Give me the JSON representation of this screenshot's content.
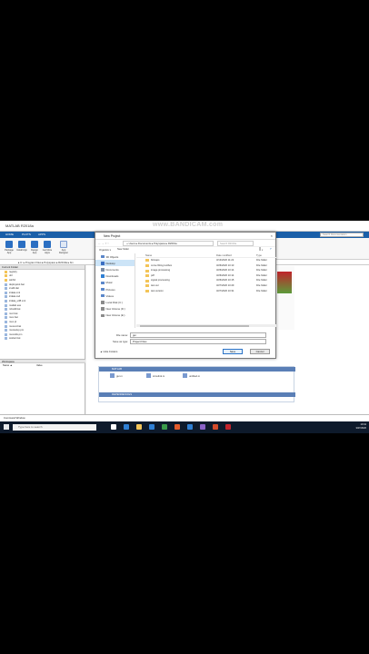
{
  "app": {
    "title": "MATLAB R2018a",
    "watermark": "www.BANDICAM.com",
    "search_placeholder": "Search Documentation"
  },
  "ribbon": {
    "tabs": [
      "HOME",
      "PLOTS",
      "APPS"
    ],
    "buttons": [
      "Package App",
      "Install App",
      "Design App",
      "Get More Apps",
      "App Designer"
    ]
  },
  "address": {
    "path": "▸ C: ▸ Program Files ▸ Polyspace ▸ R2019a ▸ bin"
  },
  "left_panel": {
    "header": "Current Folder",
    "files": [
      "registry",
      "util",
      "win64",
      "deploytool.bat",
      "icudtl.dat",
      "lcdata.xml",
      "lcdata.xsd",
      "lcdata_utf8.xml",
      "matlab.exe",
      "mbuild.bat",
      "mcc.bat",
      "mex.bat",
      "mex.pl",
      "mexext.bat",
      "mexsetup.pm",
      "mexutils.pm",
      "worker.bat"
    ],
    "workspace_header": "Workspace",
    "ws_cols": [
      "Name ▲",
      "Value"
    ]
  },
  "bg_panel": {
    "bar1": "MATLAB",
    "items": [
      "gui.m",
      "simulink.m",
      "untitled.m"
    ],
    "bar2": "DEPENDENCIES"
  },
  "command_window": {
    "label": "Command Window"
  },
  "taskbar": {
    "search": "Type here to search",
    "time": "10:41",
    "date": "3/27/2020",
    "icon_colors": [
      "#ffffff",
      "#2f7fd3",
      "#f3c458",
      "#2f7fd3",
      "#3a9a4a",
      "#e35b2b",
      "#2f7fd3",
      "#8a62c7",
      "#d34b2b",
      "#c2232b"
    ]
  },
  "dialog": {
    "title": "New Project",
    "breadcrumb": "‹‹ Users ▸ Documents ▸ Polyspace ▸ R2019a",
    "search_placeholder": "Search R2019a",
    "organize": "Organize ▾",
    "new_folder": "New folder",
    "sidebar": [
      {
        "label": "3D Objects",
        "color": "#5a86c9"
      },
      {
        "label": "Desktop",
        "color": "#3b6fc2"
      },
      {
        "label": "Documents",
        "color": "#7a8ca5"
      },
      {
        "label": "Downloads",
        "color": "#2f7fd3"
      },
      {
        "label": "Music",
        "color": "#5a86c9"
      },
      {
        "label": "Pictures",
        "color": "#5a86c9"
      },
      {
        "label": "Videos",
        "color": "#5a86c9"
      },
      {
        "label": "Local Disk (C:)",
        "color": "#8a8a8a"
      },
      {
        "label": "New Volume (D:)",
        "color": "#8a8a8a"
      },
      {
        "label": "New Volume (E:)",
        "color": "#8a8a8a"
      }
    ],
    "columns": [
      "Name",
      "Date modified",
      "Type"
    ],
    "rows": [
      {
        "name": "bitmaps",
        "date": "3/13/2020 11:22",
        "type": "File folder"
      },
      {
        "name": "curve fitting toolbox",
        "date": "3/26/2020 10:13",
        "type": "File folder"
      },
      {
        "name": "image processing",
        "date": "3/26/2020 10:14",
        "type": "File folder"
      },
      {
        "name": "pdf",
        "date": "3/26/2020 10:14",
        "type": "File folder"
      },
      {
        "name": "signal processing",
        "date": "3/26/2020 10:15",
        "type": "File folder"
      },
      {
        "name": "test ver",
        "date": "3/27/2020 10:29",
        "type": "File folder"
      },
      {
        "name": "test version",
        "date": "3/27/2020 10:31",
        "type": "File folder"
      }
    ],
    "file_name_label": "File name:",
    "file_name_value": "gui",
    "save_as_label": "Save as type:",
    "save_as_value": "Project Files",
    "hide_folders": "▲ Hide Folders",
    "save": "Save",
    "cancel": "Cancel"
  }
}
